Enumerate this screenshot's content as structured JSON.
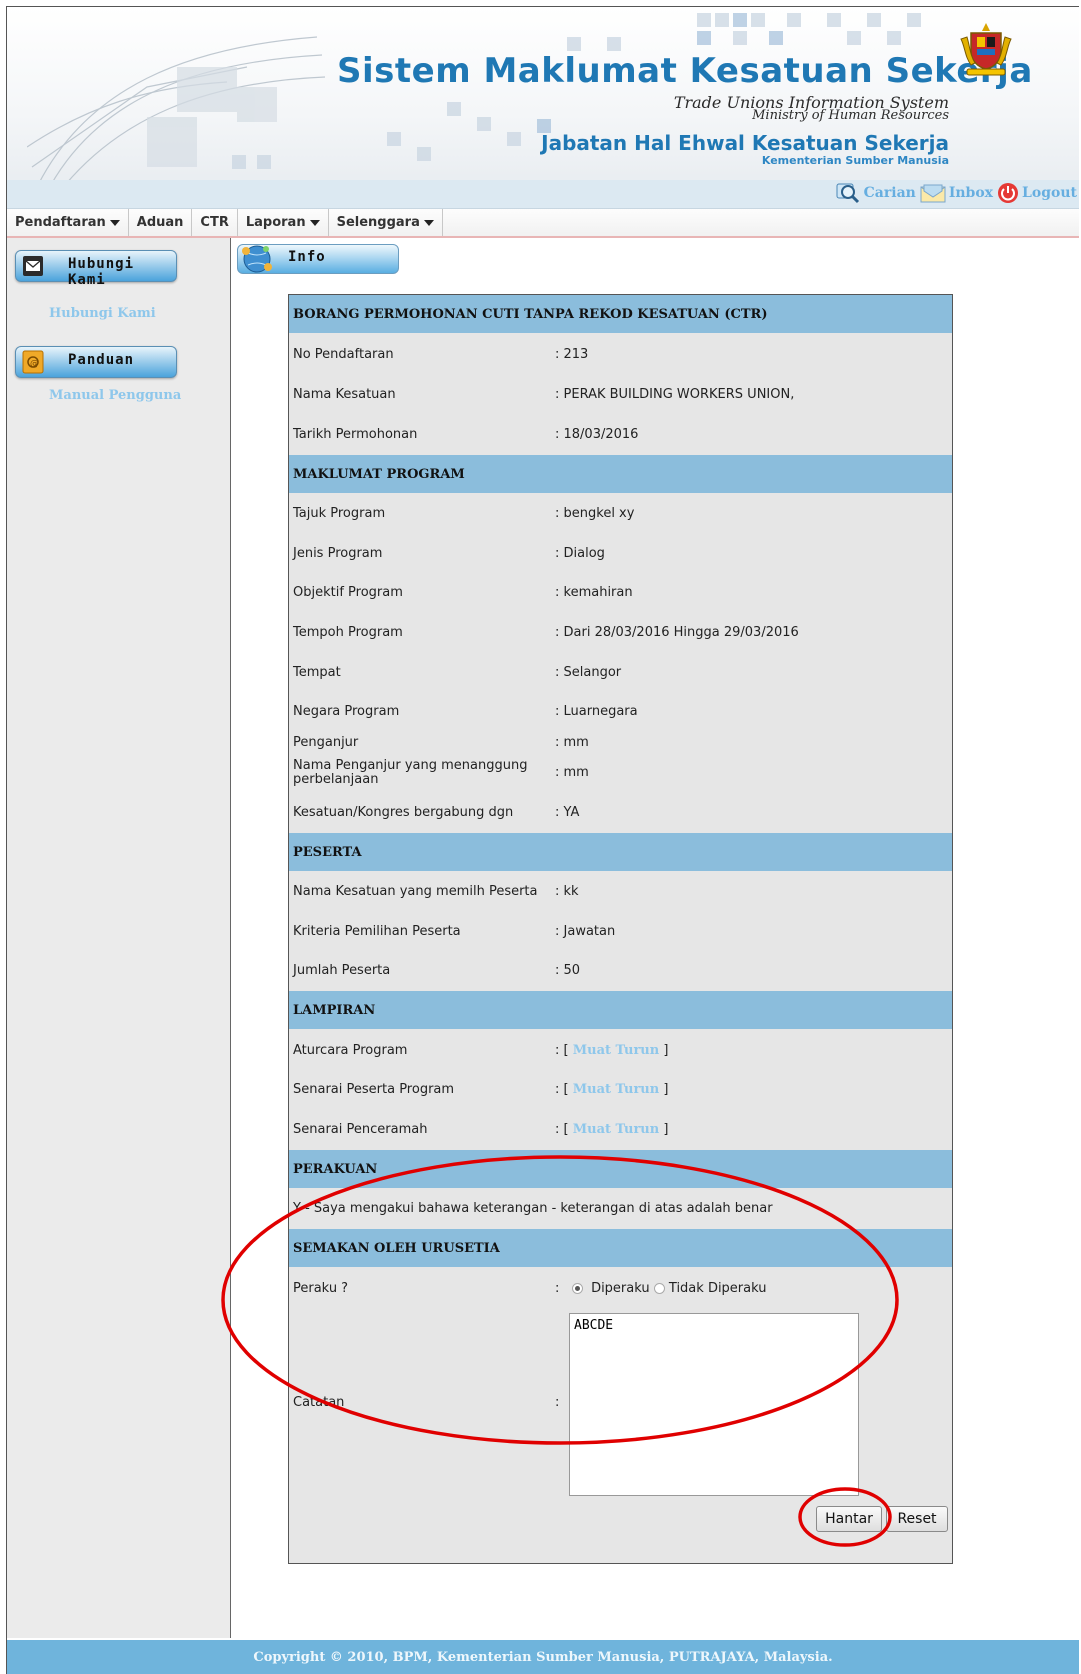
{
  "header": {
    "title": "Sistem Maklumat Kesatuan Sekerja",
    "subtitle_en": "Trade Unions Information System",
    "ministry_en": "Ministry of Human Resources",
    "department": "Jabatan Hal Ehwal Kesatuan Sekerja",
    "department_sub": "Kementerian Sumber Manusia"
  },
  "toolbar": {
    "links": [
      {
        "label": "Carian",
        "icon": "search-icon"
      },
      {
        "label": "Inbox",
        "icon": "envelope-icon"
      },
      {
        "label": "Logout",
        "icon": "power-icon"
      }
    ]
  },
  "nav": {
    "items": [
      {
        "label": "Pendaftaran",
        "dropdown": true
      },
      {
        "label": "Aduan",
        "dropdown": false
      },
      {
        "label": "CTR",
        "dropdown": false
      },
      {
        "label": "Laporan",
        "dropdown": true
      },
      {
        "label": "Selenggara",
        "dropdown": true
      }
    ]
  },
  "sidebar": {
    "contact_button": "Hubungi Kami",
    "contact_link": "Hubungi Kami",
    "guide_button": "Panduan",
    "guide_link": "Manual Pengguna"
  },
  "content": {
    "tab": "Info",
    "form_title": "BORANG PERMOHONAN CUTI TANPA REKOD KESATUAN (CTR)",
    "fields": {
      "no_pendaftaran": {
        "label": "No Pendaftaran",
        "value": ": 213"
      },
      "nama_kesatuan": {
        "label": "Nama Kesatuan",
        "value": ": PERAK BUILDING WORKERS UNION,"
      },
      "tarikh_permohonan": {
        "label": "Tarikh Permohonan",
        "value": ": 18/03/2016"
      }
    },
    "sections": {
      "program": "MAKLUMAT PROGRAM",
      "peserta": "PESERTA",
      "lampiran": "LAMPIRAN",
      "perakuan": "PERAKUAN",
      "semakan": "SEMAKAN OLEH URUSETIA"
    },
    "program": {
      "tajuk": {
        "label": "Tajuk Program",
        "value": ": bengkel xy"
      },
      "jenis": {
        "label": "Jenis Program",
        "value": ": Dialog"
      },
      "objektif": {
        "label": "Objektif Program",
        "value": ": kemahiran"
      },
      "tempoh": {
        "label": "Tempoh Program",
        "value": ": Dari 28/03/2016 Hingga 29/03/2016"
      },
      "tempat": {
        "label": "Tempat",
        "value": ": Selangor"
      },
      "negara": {
        "label": "Negara Program",
        "value": ": Luarnegara"
      },
      "penganjur": {
        "label": "Penganjur",
        "value": ": mm"
      },
      "penanggung_line1": "Nama Penganjur yang menanggung",
      "penanggung_line2": "perbelanjaan",
      "penanggung_value": ": mm",
      "kongres": {
        "label": "Kesatuan/Kongres bergabung dgn",
        "value": ": YA"
      }
    },
    "peserta": {
      "nama": {
        "label": "Nama Kesatuan yang memilh Peserta",
        "value": ": kk"
      },
      "kriteria": {
        "label": "Kriteria Pemilihan Peserta",
        "value": ": Jawatan"
      },
      "jumlah": {
        "label": "Jumlah Peserta",
        "value": ": 50"
      }
    },
    "lampiran": {
      "download_label": "Muat Turun",
      "open": ": [",
      "close": "]",
      "aturcara": "Aturcara Program",
      "senarai_peserta": "Senarai Peserta Program",
      "senarai_penceramah": "Senarai Penceramah"
    },
    "perakuan_text": "Y - Saya mengakui bahawa keterangan - keterangan di atas adalah benar",
    "semakan": {
      "peraku_label": "Peraku ?",
      "colon": ":",
      "option_yes": "Diperaku",
      "option_no": "Tidak Diperaku",
      "selected": "Diperaku",
      "catatan_label": "Catatan",
      "catatan_value": "ABCDE"
    },
    "buttons": {
      "submit": "Hantar",
      "reset": "Reset"
    }
  },
  "footer": {
    "copyright": "Copyright © 2010, BPM, Kementerian Sumber Manusia, PUTRAJAYA, Malaysia."
  },
  "colors": {
    "accent": "#1f78b4",
    "section_bg": "#8bbddc",
    "link": "#8ec7eb",
    "annotation": "#e00000"
  }
}
